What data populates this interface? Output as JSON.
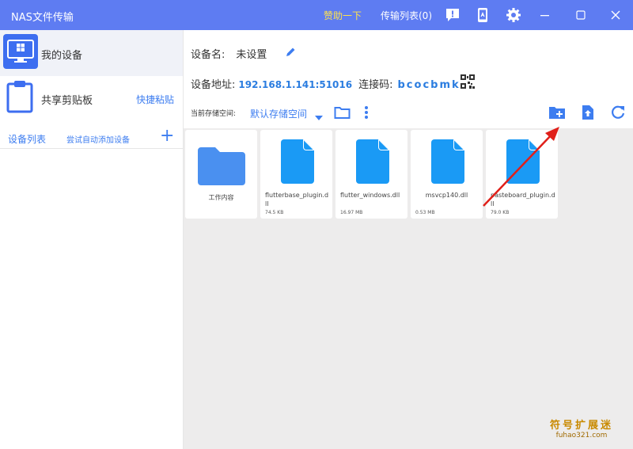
{
  "titlebar": {
    "app_title": "NAS文件传输",
    "sponsor": "赞助一下",
    "transfer_list": "传输列表(0)",
    "bg_color": "#5e7cf2",
    "sponsor_color": "#ffe24d",
    "icons": [
      "feedback-icon",
      "phone-icon",
      "settings-icon"
    ]
  },
  "sidebar": {
    "my_device": "我的设备",
    "clipboard": "共享剪贴板",
    "quick_paste": "快捷粘贴",
    "device_list": "设备列表",
    "auto_add": "尝试自动添加设备",
    "add_symbol": "+"
  },
  "device": {
    "name_label": "设备名:",
    "name_value": "未设置",
    "addr_label": "设备地址:",
    "addr_value": "192.168.1.141:51016",
    "code_label": "连接码:",
    "code_value": "bcocbmk"
  },
  "storage": {
    "label": "当前存储空间:",
    "selected": "默认存储空间"
  },
  "files": [
    {
      "name": "工作内容",
      "size": "",
      "type": "folder"
    },
    {
      "name": "flutterbase_plugin.dll",
      "size": "74.5  KB",
      "type": "file"
    },
    {
      "name": "flutter_windows.dll",
      "size": "16.97  MB",
      "type": "file"
    },
    {
      "name": "msvcp140.dll",
      "size": "0.53  MB",
      "type": "file"
    },
    {
      "name": "pasteboard_plugin.dll",
      "size": "79.0  KB",
      "type": "file"
    }
  ],
  "accent_color": "#3d7df0",
  "watermark": {
    "line1": "符号扩展迷",
    "line2": "fuhao321.com"
  }
}
